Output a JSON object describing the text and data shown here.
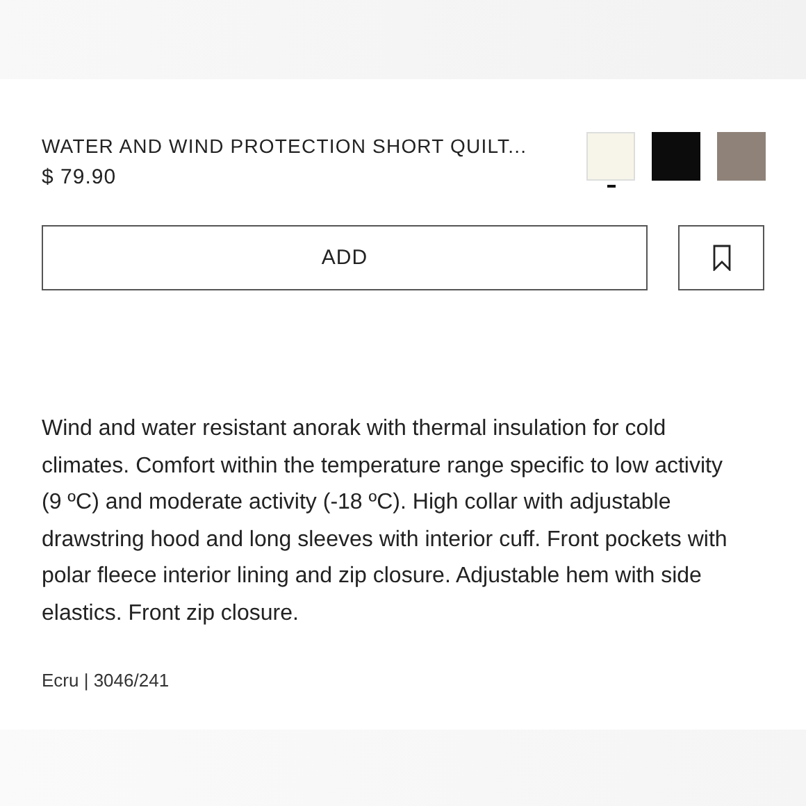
{
  "product": {
    "name": "WATER AND WIND PROTECTION SHORT QUILT...",
    "price": "$ 79.90"
  },
  "colors": [
    {
      "color": "#f7f5e9",
      "selected": true
    },
    {
      "color": "#0c0c0c",
      "selected": false
    },
    {
      "color": "#8f8279",
      "selected": false
    }
  ],
  "add_button": "ADD",
  "description": "Wind and water resistant anorak with thermal insulation for cold climates. Comfort within the temperature range specific to low activity (9 ºC) and moderate activity (-18 ºC). High collar with adjustable drawstring hood and long sleeves with interior cuff. Front pockets with polar fleece interior lining and zip closure. Adjustable hem with side elastics. Front zip closure.",
  "reference": "Ecru | 3046/241"
}
